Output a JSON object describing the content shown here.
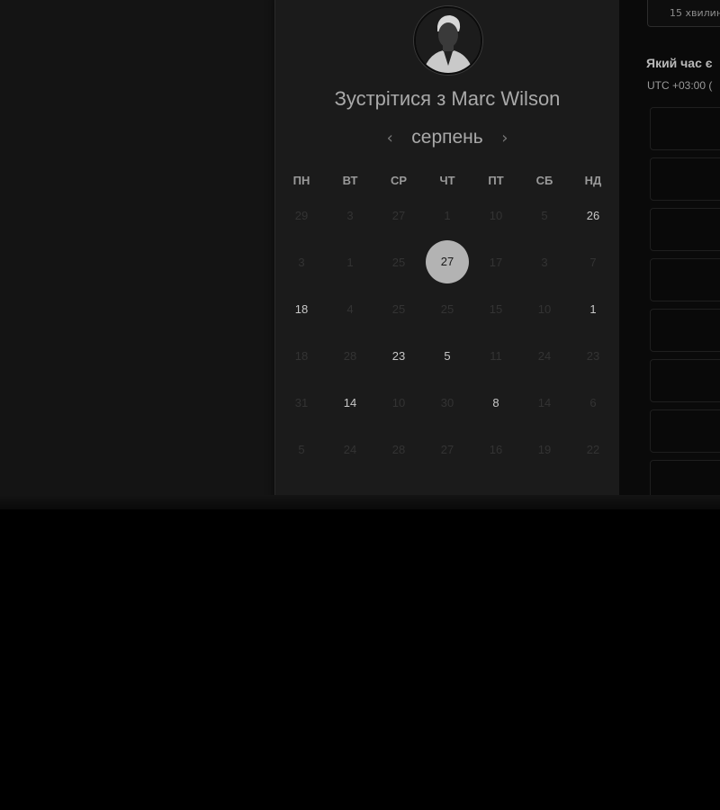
{
  "meeting": {
    "title_prefix": "Зустрітися з",
    "host_name": "Marc Wilson"
  },
  "calendar": {
    "month": "серпень",
    "prev_icon": "chevron-left-icon",
    "next_icon": "chevron-right-icon",
    "weekdays": [
      "ПН",
      "ВТ",
      "СР",
      "ЧТ",
      "ПТ",
      "СБ",
      "НД"
    ],
    "weeks": [
      [
        {
          "d": "29",
          "a": false
        },
        {
          "d": "3",
          "a": false
        },
        {
          "d": "27",
          "a": false
        },
        {
          "d": "1",
          "a": false
        },
        {
          "d": "10",
          "a": false
        },
        {
          "d": "5",
          "a": false
        },
        {
          "d": "26",
          "a": true
        }
      ],
      [
        {
          "d": "3",
          "a": false
        },
        {
          "d": "1",
          "a": false
        },
        {
          "d": "25",
          "a": false
        },
        {
          "d": "27",
          "a": true,
          "selected": true
        },
        {
          "d": "17",
          "a": false
        },
        {
          "d": "3",
          "a": false
        },
        {
          "d": "7",
          "a": false
        }
      ],
      [
        {
          "d": "18",
          "a": true
        },
        {
          "d": "4",
          "a": false
        },
        {
          "d": "25",
          "a": false
        },
        {
          "d": "25",
          "a": false
        },
        {
          "d": "15",
          "a": false
        },
        {
          "d": "10",
          "a": false
        },
        {
          "d": "1",
          "a": true
        }
      ],
      [
        {
          "d": "18",
          "a": false
        },
        {
          "d": "28",
          "a": false
        },
        {
          "d": "23",
          "a": true
        },
        {
          "d": "5",
          "a": true
        },
        {
          "d": "11",
          "a": false
        },
        {
          "d": "24",
          "a": false
        },
        {
          "d": "23",
          "a": false
        }
      ],
      [
        {
          "d": "31",
          "a": false
        },
        {
          "d": "14",
          "a": true
        },
        {
          "d": "10",
          "a": false
        },
        {
          "d": "30",
          "a": false
        },
        {
          "d": "8",
          "a": true
        },
        {
          "d": "14",
          "a": false
        },
        {
          "d": "6",
          "a": false
        }
      ],
      [
        {
          "d": "5",
          "a": false
        },
        {
          "d": "24",
          "a": false
        },
        {
          "d": "28",
          "a": false
        },
        {
          "d": "27",
          "a": false
        },
        {
          "d": "16",
          "a": false
        },
        {
          "d": "19",
          "a": false
        },
        {
          "d": "22",
          "a": false
        }
      ]
    ]
  },
  "sidebar": {
    "duration_label": "15 хвилин",
    "tz_question": "Який час є",
    "tz_value": "UTC +03:00 (",
    "slot_count_visible": 8
  }
}
